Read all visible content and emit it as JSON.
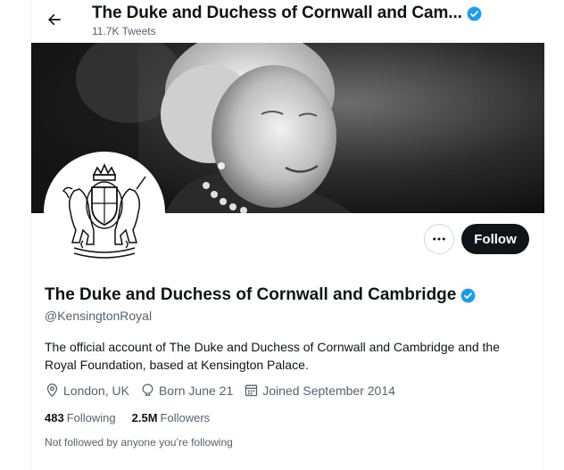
{
  "header": {
    "title": "The Duke and Duchess of Cornwall and Cam...",
    "tweet_count": "11.7K Tweets"
  },
  "profile": {
    "name": "The Duke and Duchess of Cornwall and Cambridge",
    "handle": "@KensingtonRoyal",
    "bio": "The official account of The Duke and Duchess of Cornwall and Cambridge and the Royal Foundation, based at Kensington Palace.",
    "location": "London, UK",
    "birthday": "Born June 21",
    "joined": "Joined September 2014",
    "following_count": "483",
    "following_label": "Following",
    "followers_count": "2.5M",
    "followers_label": "Followers",
    "not_followed_text": "Not followed by anyone you’re following"
  },
  "actions": {
    "follow_label": "Follow",
    "more_label": "···"
  },
  "colors": {
    "verified": "#1d9bf0",
    "follow_bg": "#0f1419",
    "secondary_text": "#536471"
  },
  "icons": [
    "back-arrow-icon",
    "verified-badge-icon",
    "more-icon",
    "location-icon",
    "birthday-icon",
    "calendar-icon"
  ]
}
